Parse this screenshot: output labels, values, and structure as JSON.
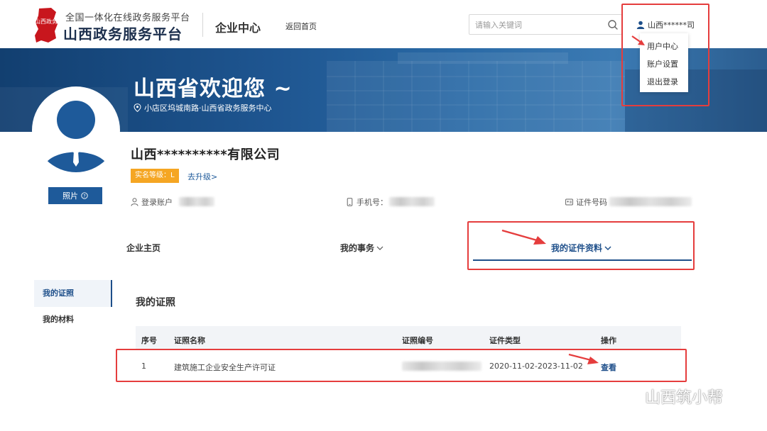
{
  "header": {
    "logo_text": "山西政务",
    "logo_subtitle": "全国一体化在线政务服务平台",
    "logo_title": "山西政务服务平台",
    "portal_title": "企业中心",
    "back_home": "返回首页",
    "search_placeholder": "请输入关键词",
    "user_name": "山西******司"
  },
  "user_menu": {
    "items": [
      "用户中心",
      "账户设置",
      "退出登录"
    ]
  },
  "banner": {
    "welcome": "山西省欢迎您 ~",
    "address": "小店区坞城南路·山西省政务服务中心"
  },
  "profile": {
    "photo_button": "照片",
    "company_name": "山西**********有限公司",
    "auth_level": "实名等级：L",
    "upgrade": "去升级>",
    "login_account_label": "登录账户",
    "phone_label": "手机号：",
    "cert_no_label": "证件号码"
  },
  "nav": {
    "tabs": [
      "企业主页",
      "我的事务",
      "我的证件资料"
    ]
  },
  "sidebar": {
    "items": [
      "我的证照",
      "我的材料"
    ]
  },
  "certificates": {
    "title": "我的证照",
    "columns": [
      "序号",
      "证照名称",
      "证照编号",
      "证件类型",
      "操作"
    ],
    "rows": [
      {
        "index": "1",
        "name": "建筑施工企业安全生产许可证",
        "type": "2020-11-02-2023-11-02",
        "action": "查看"
      }
    ]
  },
  "watermark": {
    "text": "山西筑小帮"
  },
  "colors": {
    "primary": "#1e4f8a",
    "badge": "#f5a623",
    "highlight": "#e53d3d",
    "banner": "#1e5590"
  }
}
